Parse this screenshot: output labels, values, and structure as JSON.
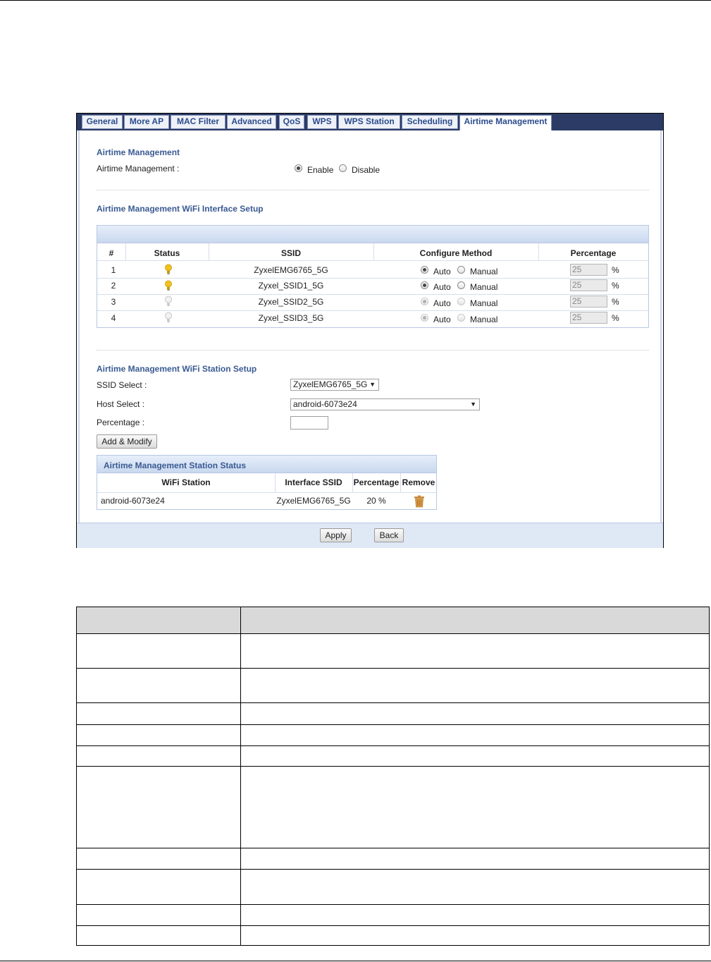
{
  "tabs": [
    {
      "label": "General"
    },
    {
      "label": "More AP"
    },
    {
      "label": "MAC Filter"
    },
    {
      "label": "Advanced"
    },
    {
      "label": "QoS"
    },
    {
      "label": "WPS"
    },
    {
      "label": "WPS Station"
    },
    {
      "label": "Scheduling"
    },
    {
      "label": "Airtime Management",
      "active": true
    }
  ],
  "airtime": {
    "section_title": "Airtime Management",
    "field_label": "Airtime Management :",
    "enable_label": "Enable",
    "disable_label": "Disable",
    "selected": "Enable"
  },
  "interface_setup": {
    "section_title": "Airtime Management WiFi Interface Setup",
    "headers": {
      "num": "#",
      "status": "Status",
      "ssid": "SSID",
      "method": "Configure Method",
      "percentage": "Percentage"
    },
    "auto_label": "Auto",
    "manual_label": "Manual",
    "pct_unit": "%",
    "rows": [
      {
        "num": "1",
        "status": "on",
        "ssid": "ZyxelEMG6765_5G",
        "method": "Auto",
        "percentage": "25"
      },
      {
        "num": "2",
        "status": "on",
        "ssid": "Zyxel_SSID1_5G",
        "method": "Auto",
        "percentage": "25"
      },
      {
        "num": "3",
        "status": "off",
        "ssid": "Zyxel_SSID2_5G",
        "method": "Auto",
        "percentage": "25"
      },
      {
        "num": "4",
        "status": "off",
        "ssid": "Zyxel_SSID3_5G",
        "method": "Auto",
        "percentage": "25"
      }
    ]
  },
  "station_setup": {
    "section_title": "Airtime Management WiFi Station Setup",
    "ssid_select_label": "SSID Select :",
    "ssid_select_value": "ZyxelEMG6765_5G",
    "host_select_label": "Host Select :",
    "host_select_value": "android-6073e24",
    "percentage_label": "Percentage :",
    "percentage_value": "",
    "add_modify_label": "Add & Modify"
  },
  "station_status": {
    "title": "Airtime Management Station Status",
    "headers": {
      "station": "WiFi Station",
      "iface": "Interface SSID",
      "percentage": "Percentage",
      "remove": "Remove"
    },
    "rows": [
      {
        "station": "android-6073e24",
        "iface": "ZyxelEMG6765_5G",
        "percentage": "20 %"
      }
    ]
  },
  "buttons": {
    "apply": "Apply",
    "back": "Back"
  },
  "colors": {
    "tabbar": "#2b3b66",
    "title_blue": "#3a5a92",
    "bulb_on": "#f2c21b",
    "bulb_off": "#cfcfcf",
    "trash": "#c98a3a"
  }
}
